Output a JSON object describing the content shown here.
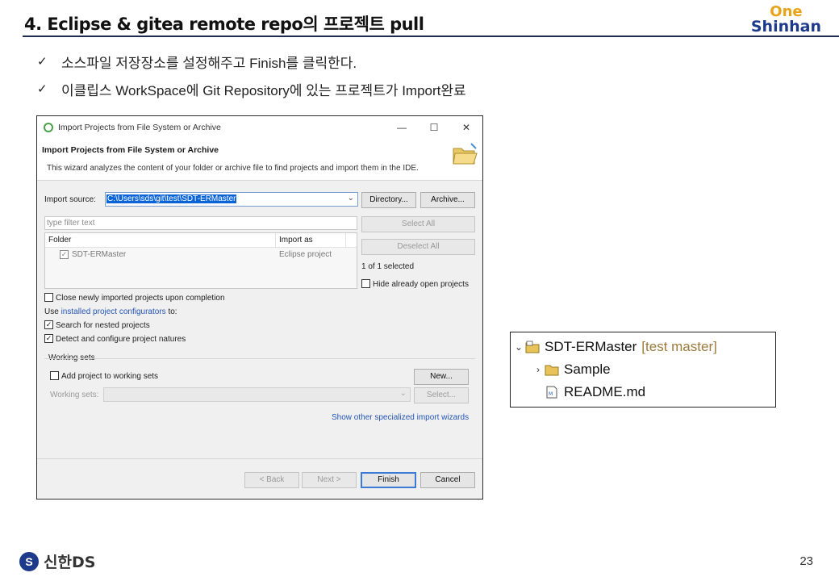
{
  "slide": {
    "title": "4. Eclipse & gitea remote repo의 프로젝트 pull",
    "logo_top": "One",
    "logo_bottom": "Shinhan",
    "bullets": [
      "소스파일 저장장소를 설정해주고 Finish를 클릭한다.",
      "이클립스 WorkSpace에 Git Repository에 있는 프로젝트가 Import완료"
    ],
    "check_glyph": "✓",
    "footer_logo_mark": "S",
    "footer_logo_text": "신한DS",
    "page_number": "23"
  },
  "dialog": {
    "window_title": "Import Projects from File System or Archive",
    "header_title": "Import Projects from File System or Archive",
    "header_desc": "This wizard analyzes the content of your folder or archive file to find projects and import them in the IDE.",
    "import_source_label": "Import source:",
    "import_source_value": "C:\\Users\\sds\\git\\test\\SDT-ERMaster",
    "directory_button": "Directory...",
    "archive_button": "Archive...",
    "filter_placeholder": "type filter text",
    "select_all": "Select All",
    "deselect_all": "Deselect All",
    "selected_count": "1 of 1 selected",
    "hide_open": "Hide already open projects",
    "columns": [
      "Folder",
      "Import as"
    ],
    "rows": [
      {
        "folder": "SDT-ERMaster",
        "import_as": "Eclipse project",
        "checked": true
      }
    ],
    "close_newly": "Close newly imported projects upon completion",
    "use_prefix": "Use",
    "configurators_link": "installed project configurators",
    "use_suffix": "to:",
    "search_nested": "Search for nested projects",
    "detect_natures": "Detect and configure project natures",
    "working_sets_label": "Working sets",
    "add_to_working_sets": "Add project to working sets",
    "new_button": "New...",
    "working_sets_field_label": "Working sets:",
    "select_button": "Select...",
    "specialized_link": "Show other specialized import wizards",
    "back": "< Back",
    "next": "Next >",
    "finish": "Finish",
    "cancel": "Cancel",
    "minimize": "—",
    "maximize": "☐",
    "close": "✕"
  },
  "explorer": {
    "project": "SDT-ERMaster",
    "decoration": "[test master]",
    "children": [
      "Sample",
      "README.md"
    ],
    "expanded_glyph": "⌄",
    "collapsed_glyph": "›"
  },
  "colors": {
    "accent": "#1d3a8a",
    "logo_one": "#e8a319",
    "selection": "#0a64d8",
    "link": "#2456b4",
    "git_decoration": "#9c7a3c"
  }
}
